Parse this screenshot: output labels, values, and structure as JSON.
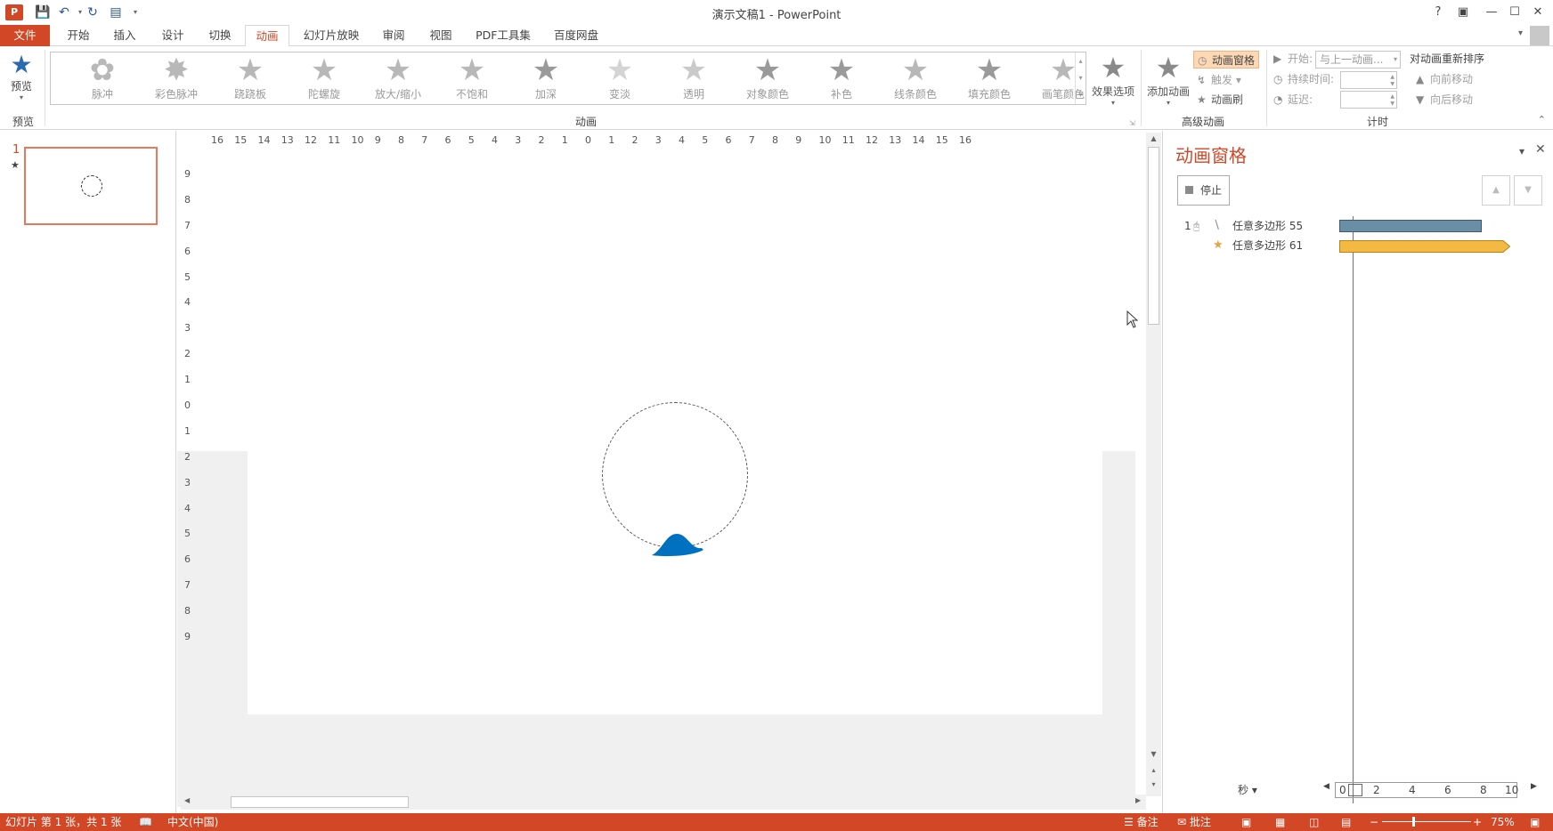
{
  "window": {
    "title": "演示文稿1 - PowerPoint",
    "app_badge": "P",
    "help": "?",
    "controls": [
      "restore-ribbon",
      "minimize",
      "maximize",
      "close"
    ]
  },
  "tabs": {
    "file": "文件",
    "items": [
      "开始",
      "插入",
      "设计",
      "切换",
      "动画",
      "幻灯片放映",
      "审阅",
      "视图",
      "PDF工具集",
      "百度网盘"
    ],
    "active": "动画"
  },
  "ribbon": {
    "preview": {
      "label": "预览",
      "group": "预览"
    },
    "animations_group": "动画",
    "animations": [
      "脉冲",
      "彩色脉冲",
      "跷跷板",
      "陀螺旋",
      "放大/缩小",
      "不饱和",
      "加深",
      "变淡",
      "透明",
      "对象颜色",
      "补色",
      "线条颜色",
      "填充颜色",
      "画笔颜色"
    ],
    "effect_options": "效果选项",
    "advanced_group": "高级动画",
    "add_animation": "添加动画",
    "animation_pane": "动画窗格",
    "trigger": "触发",
    "animation_painter": "动画刷",
    "timing_group": "计时",
    "start_label": "开始:",
    "start_value": "与上一动画...",
    "duration_label": "持续时间:",
    "delay_label": "延迟:",
    "reorder_title": "对动画重新排序",
    "move_earlier": "向前移动",
    "move_later": "向后移动"
  },
  "thumbnails": {
    "slide_number": "1",
    "anim_marker": "★"
  },
  "ruler": {
    "horizontal": [
      "16",
      "15",
      "14",
      "13",
      "12",
      "11",
      "10",
      "9",
      "8",
      "7",
      "6",
      "5",
      "4",
      "3",
      "2",
      "1",
      "0",
      "1",
      "2",
      "3",
      "4",
      "5",
      "6",
      "7",
      "8",
      "9",
      "10",
      "11",
      "12",
      "13",
      "14",
      "15",
      "16"
    ],
    "vertical": [
      "9",
      "8",
      "7",
      "6",
      "5",
      "4",
      "3",
      "2",
      "1",
      "0",
      "1",
      "2",
      "3",
      "4",
      "5",
      "6",
      "7",
      "8",
      "9"
    ]
  },
  "anim_pane": {
    "title": "动画窗格",
    "stop": "停止",
    "items": [
      {
        "index": "1",
        "name": "任意多边形 55",
        "effect": "motion-path"
      },
      {
        "index": "",
        "name": "任意多边形 61",
        "effect": "emphasis"
      }
    ],
    "unit": "秒",
    "scale": [
      "0",
      "2",
      "4",
      "6",
      "8",
      "10"
    ]
  },
  "status": {
    "slide_info": "幻灯片 第 1 张，共 1 张",
    "language": "中文(中国)",
    "notes": "备注",
    "comments": "批注",
    "zoom": "75%"
  },
  "colors": {
    "accent": "#d24726",
    "shape_fill": "#0070c0",
    "bar_motion": "#6a8ea6",
    "bar_emphasis": "#f4b942"
  }
}
